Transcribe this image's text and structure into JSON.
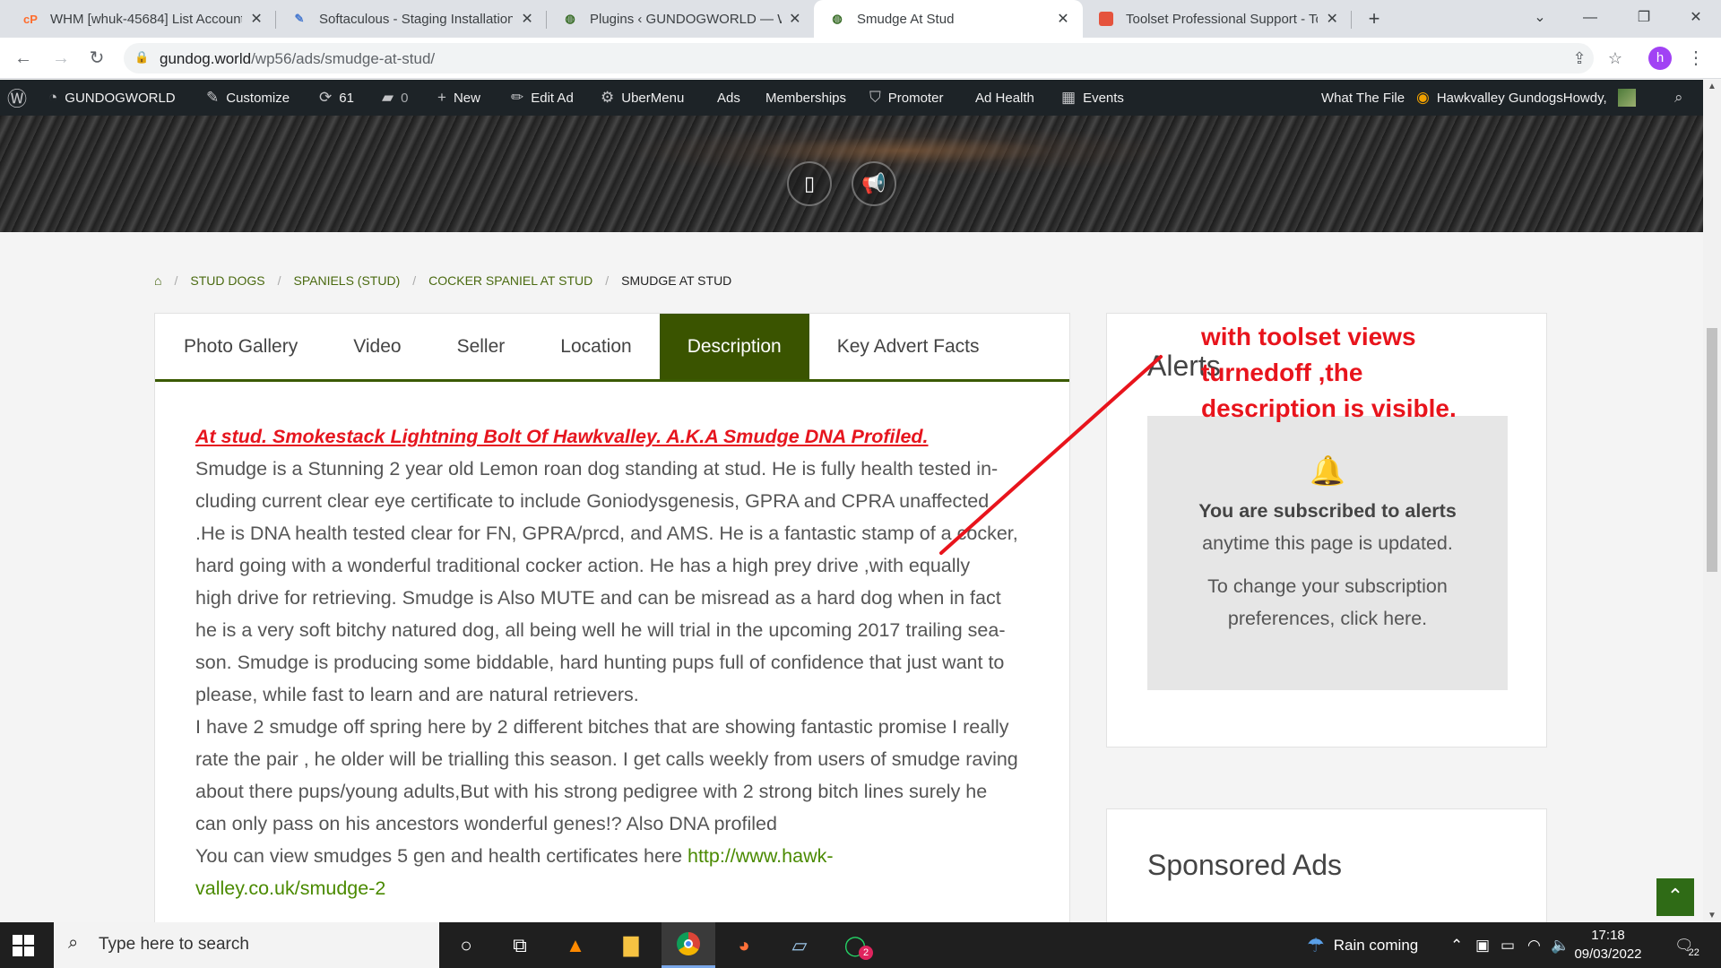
{
  "browser": {
    "tabs": [
      {
        "title": "WHM [whuk-45684] List Account",
        "icon": "cpanel-icon"
      },
      {
        "title": "Softaculous - Staging Installation",
        "icon": "softaculous-icon"
      },
      {
        "title": "Plugins ‹ GUNDOGWORLD — Wo",
        "icon": "wordpress-icon"
      },
      {
        "title": "Smudge At Stud",
        "icon": "site-icon"
      },
      {
        "title": "Toolset Professional Support - To",
        "icon": "toolset-icon"
      }
    ],
    "url_host": "gundog.world",
    "url_path": "/wp56/ads/smudge-at-stud/",
    "profile_initial": "h"
  },
  "adminbar": {
    "site": "GUNDOGWORLD",
    "customize": "Customize",
    "updates": "61",
    "comments": "0",
    "new": "New",
    "edit": "Edit Ad",
    "ubermenu": "UberMenu",
    "ads": "Ads",
    "memberships": "Memberships",
    "promoter": "Promoter",
    "adhealth": "Ad Health",
    "events": "Events",
    "whatthefile": "What The File",
    "user": "Hawkvalley GundogsHowdy,"
  },
  "breadcrumb": [
    "STUD DOGS",
    "SPANIELS (STUD)",
    "COCKER SPANIEL AT STUD",
    "SMUDGE AT STUD"
  ],
  "tabs": [
    "Photo Gallery",
    "Video",
    "Seller",
    "Location",
    "Description",
    "Key Advert Facts"
  ],
  "description": {
    "heading": "At stud. Smokestack Lightning Bolt Of Hawkvalley. A.K.A Smudge DNA Profiled.",
    "p1_l1": "Smudge is a Stunning 2 year old Lemon roan dog standing at stud. He is fully health tested in-",
    "p1_l2": "cluding current clear eye certificate to include Goniodysgenesis, GPRA and CPRA unaffected",
    "p1_l3": ".He is DNA health tested clear for FN, GPRA/prcd, and AMS. He is a fantastic stamp of a cocker,",
    "p1_l4": "hard going with a wonderful traditional cocker action. He has a high prey drive ,with equally",
    "p1_l5": "high drive for retrieving. Smudge is Also MUTE and can be misread as a hard dog when in fact",
    "p1_l6": "he is a very soft bitchy natured dog, all being well he will trial in the upcoming 2017 trailing sea-",
    "p1_l7": "son. Smudge is producing some biddable, hard hunting pups full of confidence that just want to",
    "p1_l8": "please, while fast to learn and are natural retrievers.",
    "p2_l1": "I have 2 smudge off spring here by 2 different bitches that are showing fantastic promise I really",
    "p2_l2": "rate the pair , he older will be trialling this season. I get calls weekly from users of smudge raving",
    "p2_l3": "about there pups/young adults,But with his strong pedigree with 2 strong bitch lines surely he",
    "p2_l4": "can only pass on his ancestors wonderful genes!? Also DNA profiled",
    "p3_text": "You can view smudges 5 gen and health certificates here ",
    "p3_link1": "http://www.hawk-",
    "p3_link2": "valley.co.uk/smudge-2"
  },
  "alerts": {
    "title": "Alerts",
    "bold": "You are subscribed to alerts",
    "line2": "anytime this page is updated.",
    "line3": "To change your subscription",
    "line4": "preferences, click here."
  },
  "sponsored": {
    "title": "Sponsored Ads"
  },
  "annotation": {
    "l1": "with toolset views",
    "l2": "turnedoff ,the",
    "l3": "description is visible.",
    "color": "#e8141c"
  },
  "taskbar": {
    "search_placeholder": "Type here to search",
    "weather": "Rain coming",
    "time": "17:18",
    "date": "09/03/2022",
    "notifications": "22",
    "whatsapp_badge": "2"
  },
  "colors": {
    "accent": "#3a5400",
    "link": "#4a6a10"
  }
}
